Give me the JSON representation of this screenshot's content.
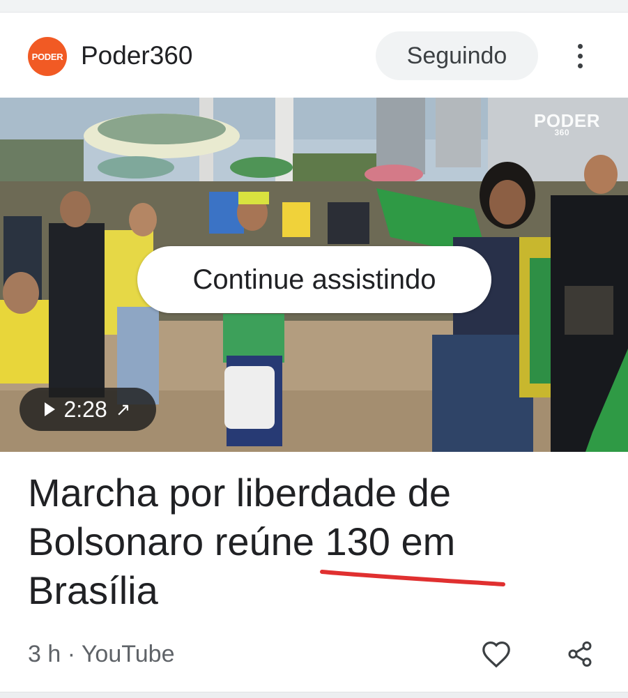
{
  "publisher": {
    "logo_text": "PODER",
    "name": "Poder360",
    "follow_label": "Seguindo"
  },
  "video": {
    "watermark": "PODER",
    "watermark_sub": "360",
    "continue_label": "Continue assistindo",
    "duration": "2:28"
  },
  "article": {
    "headline_line1": "Marcha por liberdade de",
    "headline_line2_start": "Bolsonaro reúne ",
    "headline_line2_highlight": "130 em",
    "headline_line3": "Brasília",
    "meta": "3 h · YouTube"
  },
  "icons": {
    "more": "more-vert-icon",
    "play": "play-icon",
    "external": "open-external-icon",
    "heart": "heart-outline-icon",
    "share": "share-icon"
  },
  "colors": {
    "accent_logo": "#f15a24",
    "annotation_underline": "#e03030",
    "text_primary": "#202124",
    "text_secondary": "#5f6368"
  }
}
